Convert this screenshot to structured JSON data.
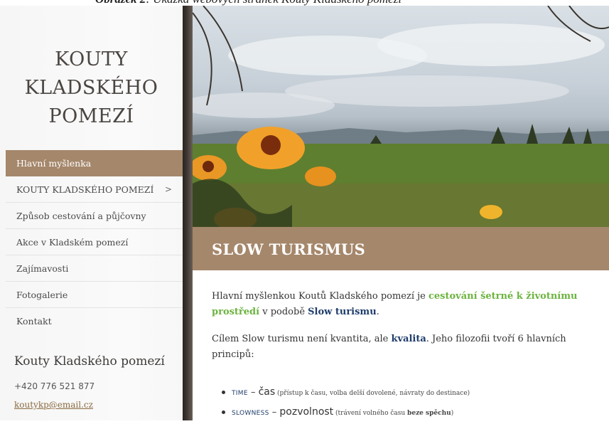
{
  "caption": {
    "prefix": "Obrázek 2",
    "text": ": Ukázka webových stránek Kouty Kladského pomezí"
  },
  "sidebar": {
    "site_title": [
      "KOUTY",
      "KLADSKÉHO",
      "POMEZÍ"
    ],
    "nav": [
      {
        "label": "Hlavní myšlenka",
        "active": true
      },
      {
        "label": "KOUTY KLADSKÉHO POMEZÍ",
        "submenu_indicator": ">"
      },
      {
        "label": "Způsob cestování a půjčovny"
      },
      {
        "label": "Akce v Kladském pomezí"
      },
      {
        "label": "Zajímavosti"
      },
      {
        "label": "Fotogalerie"
      },
      {
        "label": "Kontakt"
      }
    ],
    "contact": {
      "title": "Kouty Kladského pomezí",
      "phone": "+420 776 521 877",
      "email": "koutykp@email.cz"
    }
  },
  "main": {
    "heading": "SLOW TURISMUS",
    "paragraph1": {
      "a": "Hlavní myšlenkou Koutů Kladského pomezí je ",
      "b": "cestování šetrné k životnímu prostředí",
      "c": " v podobě ",
      "d": "Slow turismu",
      "e": "."
    },
    "paragraph2": {
      "a": "Cílem Slow turismu není kvantita, ale ",
      "b": "kvalita",
      "c": ". Jeho filozofii tvoří 6 hlavních principů:"
    },
    "principles": [
      {
        "keyword": "TIME",
        "dash": " – ",
        "czech": "čas",
        "note": " (přístup k času, volba delší dovolené, návraty do destinace)",
        "note_bold": "",
        "note_end": ""
      },
      {
        "keyword": "SLOWNESS",
        "dash": " – ",
        "czech": "pozvolnost",
        "note": " (trávení volného času ",
        "note_bold": "beze spěchu",
        "note_end": ")"
      }
    ]
  },
  "colors": {
    "accent_brown": "#a5876b",
    "green_highlight": "#6cb33f",
    "navy_highlight": "#1f3d6b"
  }
}
